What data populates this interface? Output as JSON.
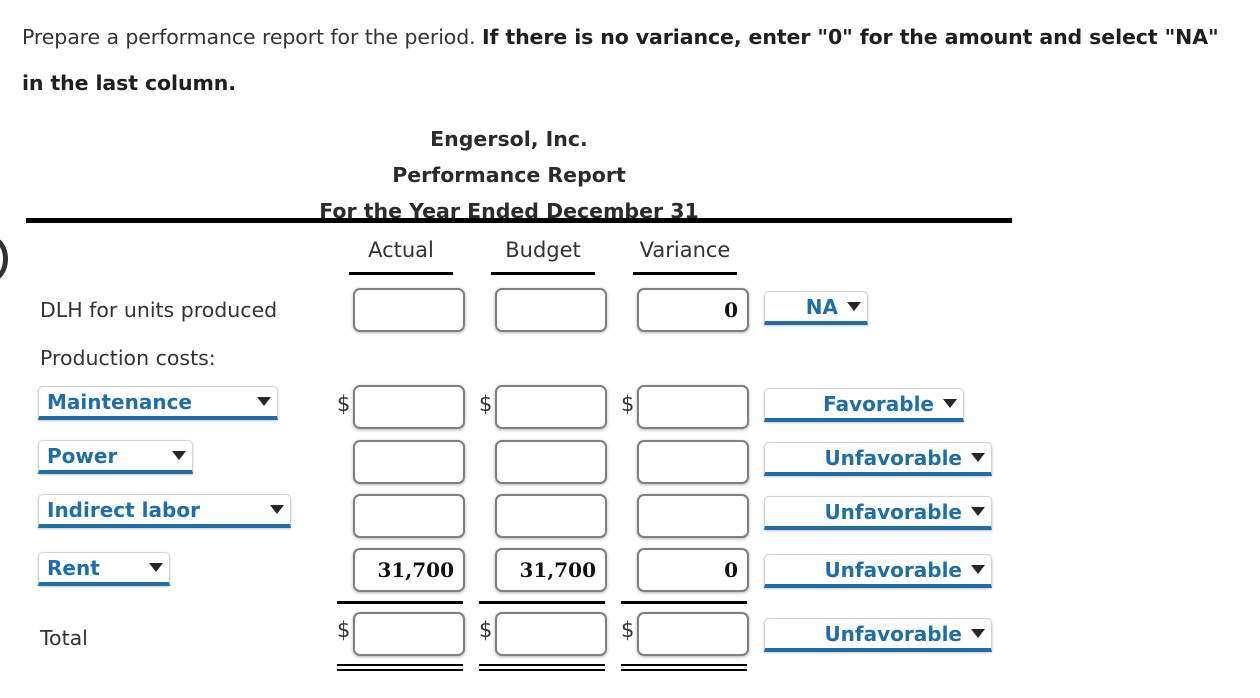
{
  "instructions": {
    "plain": "Prepare a performance report for the period. ",
    "bold": "If there is no variance, enter \"0\" for the amount and select \"NA\" in the last column."
  },
  "report": {
    "company": "Engersol, Inc.",
    "title": "Performance Report",
    "period": "For the Year Ended December 31"
  },
  "columns": {
    "actual": "Actual",
    "budget": "Budget",
    "variance": "Variance"
  },
  "currency_symbol": "$",
  "status_options": [
    "Favorable",
    "Unfavorable",
    "NA"
  ],
  "account_options": [
    "Maintenance",
    "Power",
    "Indirect labor",
    "Rent"
  ],
  "rows": [
    {
      "label": "DLH for units produced",
      "label_kind": "text",
      "actual": "",
      "budget": "",
      "variance": "0",
      "status": "NA",
      "show_dollar": false
    },
    {
      "label": "Production costs:",
      "label_kind": "section",
      "actual": null,
      "budget": null,
      "variance": null,
      "status": null,
      "show_dollar": false
    },
    {
      "label": "Maintenance",
      "label_kind": "select",
      "actual": "",
      "budget": "",
      "variance": "",
      "status": "Favorable",
      "show_dollar": true
    },
    {
      "label": "Power",
      "label_kind": "select",
      "actual": "",
      "budget": "",
      "variance": "",
      "status": "Unfavorable",
      "show_dollar": false
    },
    {
      "label": "Indirect labor",
      "label_kind": "select",
      "actual": "",
      "budget": "",
      "variance": "",
      "status": "Unfavorable",
      "show_dollar": false
    },
    {
      "label": "Rent",
      "label_kind": "select",
      "actual": "31,700",
      "budget": "31,700",
      "variance": "0",
      "status": "Unfavorable",
      "show_dollar": false
    },
    {
      "label": "Total",
      "label_kind": "text",
      "actual": "",
      "budget": "",
      "variance": "",
      "status": "Unfavorable",
      "show_dollar": true
    }
  ],
  "colors": {
    "accent_blue": "#1f6ea8",
    "rule_black": "#000000",
    "text_gray": "#333333",
    "field_border": "#808080"
  }
}
